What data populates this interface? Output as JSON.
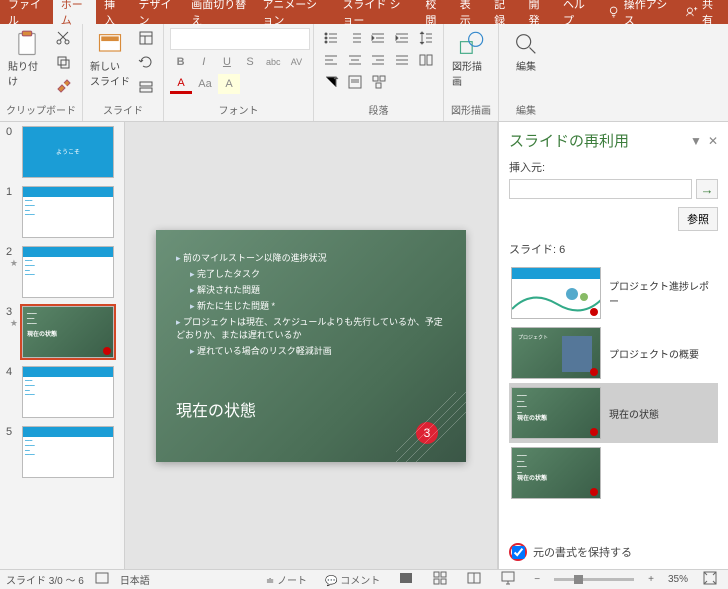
{
  "tabs": {
    "items": [
      "ファイル",
      "ホーム",
      "挿入",
      "デザイン",
      "画面切り替え",
      "アニメーション",
      "スライド ショー",
      "校閲",
      "表示",
      "記録",
      "開発",
      "ヘルプ"
    ],
    "active_index": 1,
    "tell_me": "操作アシス",
    "share": "共有"
  },
  "ribbon": {
    "clipboard": {
      "label": "クリップボード",
      "paste": "貼り付け"
    },
    "slides": {
      "label": "スライド",
      "new_slide": "新しい\nスライド"
    },
    "font": {
      "label": "フォント",
      "buttons": [
        "B",
        "I",
        "U",
        "S",
        "abc",
        "AV"
      ],
      "row2": [
        "A",
        "Aa",
        "A"
      ]
    },
    "paragraph": {
      "label": "段落"
    },
    "drawing": {
      "label": "図形描画"
    },
    "editing": {
      "label": "編集"
    }
  },
  "thumbnails": [
    {
      "num": "0",
      "star": false,
      "kind": "blue-title"
    },
    {
      "num": "1",
      "star": false,
      "kind": "white-list"
    },
    {
      "num": "2",
      "star": true,
      "kind": "white-img"
    },
    {
      "num": "3",
      "star": true,
      "kind": "green",
      "selected": true,
      "badge": true
    },
    {
      "num": "4",
      "star": false,
      "kind": "white-list"
    },
    {
      "num": "5",
      "star": false,
      "kind": "white-img"
    }
  ],
  "slide": {
    "bullets": [
      {
        "lvl": 1,
        "text": "前のマイルストーン以降の進捗状況"
      },
      {
        "lvl": 2,
        "text": "完了したタスク"
      },
      {
        "lvl": 2,
        "text": "解決された問題"
      },
      {
        "lvl": 2,
        "text": "新たに生じた問題 *"
      },
      {
        "lvl": 1,
        "text": "プロジェクトは現在、スケジュールよりも先行しているか、予定どおりか、または遅れているか"
      },
      {
        "lvl": 2,
        "text": "遅れている場合のリスク軽減計画"
      }
    ],
    "title": "現在の状態",
    "indicator": "3"
  },
  "panel": {
    "title": "スライドの再利用",
    "from_label": "挿入元:",
    "from_value": "",
    "browse": "参照",
    "count_label": "スライド: 6",
    "items": [
      {
        "title": "プロジェクト進捗レポー",
        "kind": "white",
        "sel": false
      },
      {
        "title": "プロジェクトの概要",
        "kind": "green-img",
        "sel": false
      },
      {
        "title": "現在の状態",
        "kind": "green",
        "sel": true
      },
      {
        "title": "",
        "kind": "green",
        "sel": false
      }
    ],
    "keep_format": "元の書式を保持する"
  },
  "status": {
    "slide_pos": "スライド 3/0 ～ 6",
    "lang": "日本語",
    "notes": "ノート",
    "comments": "コメント",
    "zoom": "35%"
  }
}
